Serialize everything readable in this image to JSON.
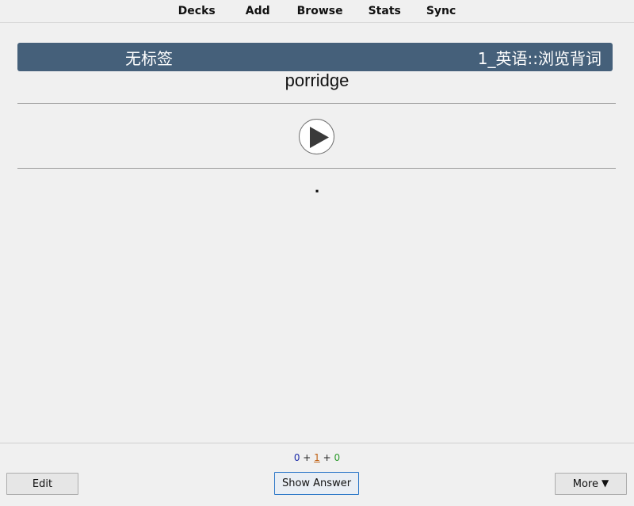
{
  "nav": {
    "items": [
      "Decks",
      "Add",
      "Browse",
      "Stats",
      "Sync"
    ]
  },
  "card": {
    "tags_label": "无标签",
    "deck_path": "1_英语::浏览背词",
    "word": "porridge",
    "dot": "."
  },
  "counts": {
    "new": "0",
    "plus1": "+",
    "learning": "1",
    "plus2": "+",
    "review": "0"
  },
  "buttons": {
    "edit": "Edit",
    "show_answer": "Show Answer",
    "more": "More",
    "more_caret": "▼"
  },
  "colors": {
    "banner": "#45607a",
    "new_count": "#1a2aa8",
    "learning_count": "#c06012",
    "review_count": "#2c9a2c",
    "focus_border": "#2d78c8"
  },
  "icons": {
    "play": "play-icon"
  }
}
